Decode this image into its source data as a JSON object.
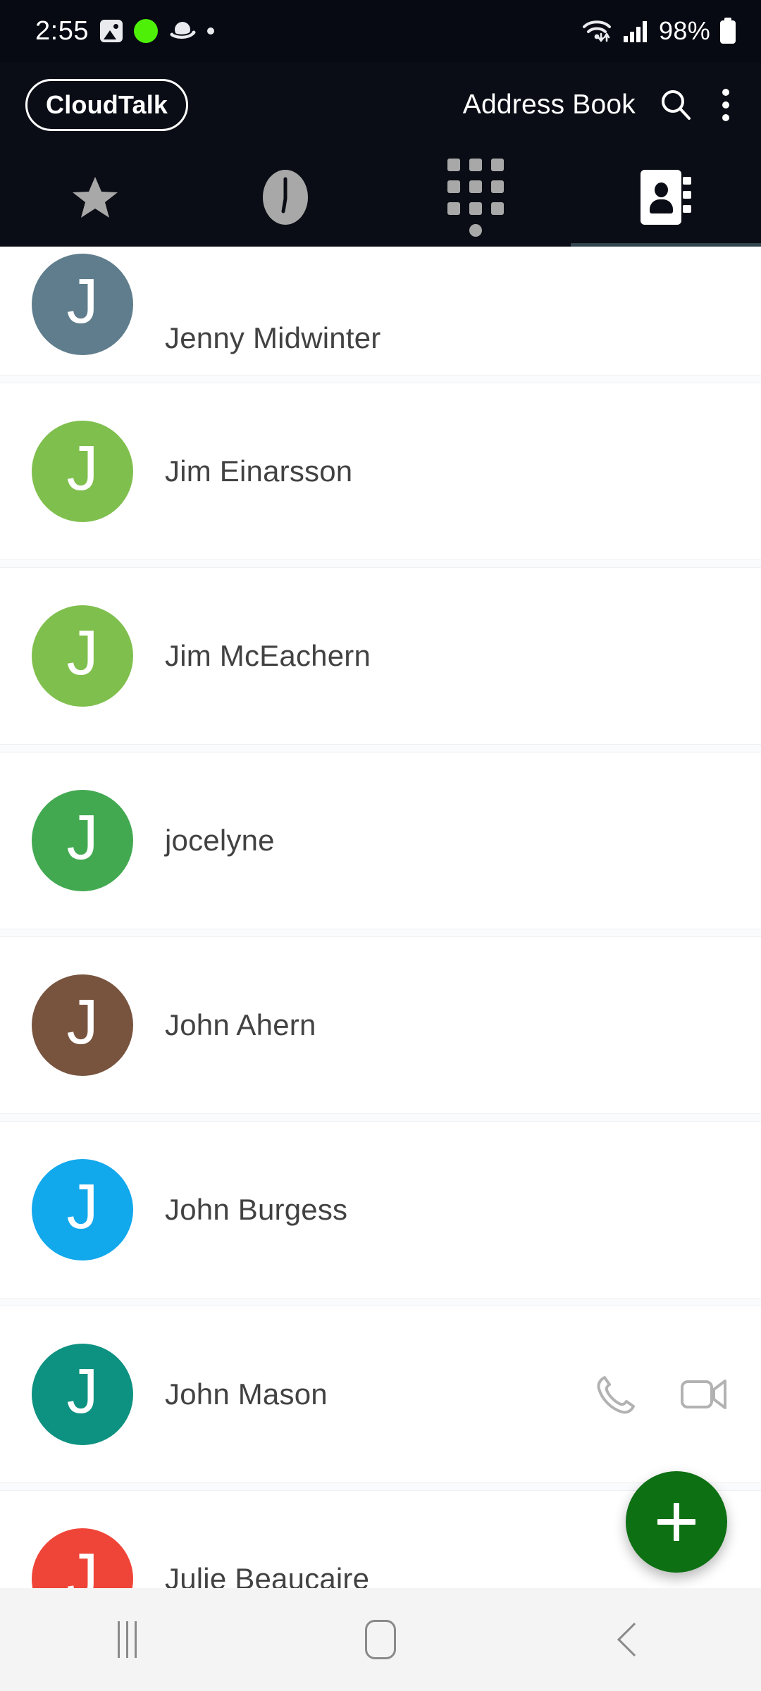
{
  "status_bar": {
    "time": "2:55",
    "battery_percent": "98%",
    "icons": [
      "photos-icon",
      "green-dot-icon",
      "planet-icon",
      "small-dot-icon",
      "wifi-icon",
      "signal-icon",
      "battery-icon"
    ]
  },
  "header": {
    "brand": "CloudTalk",
    "title": "Address Book",
    "search_icon": "search-icon",
    "overflow_icon": "more-vertical-icon"
  },
  "tabs": {
    "items": [
      {
        "name": "favorites",
        "icon": "star-icon",
        "active": false
      },
      {
        "name": "recents",
        "icon": "clock-icon",
        "active": false
      },
      {
        "name": "dialpad",
        "icon": "dialpad-icon",
        "active": false
      },
      {
        "name": "contacts",
        "icon": "contacts-book-icon",
        "active": true
      }
    ],
    "indicator_color": "#32444C"
  },
  "contacts": [
    {
      "name": "Jenny Midwinter",
      "initial": "J",
      "avatar_color": "#5F7D8C",
      "partial": true,
      "actions": false
    },
    {
      "name": "Jim Einarsson",
      "initial": "J",
      "avatar_color": "#7FBF4D",
      "partial": false,
      "actions": false
    },
    {
      "name": "Jim McEachern",
      "initial": "J",
      "avatar_color": "#7FBF4D",
      "partial": false,
      "actions": false
    },
    {
      "name": "jocelyne",
      "initial": "J",
      "avatar_color": "#42A951",
      "partial": false,
      "actions": false
    },
    {
      "name": "John Ahern",
      "initial": "J",
      "avatar_color": "#78543F",
      "partial": false,
      "actions": false
    },
    {
      "name": "John Burgess",
      "initial": "J",
      "avatar_color": "#12A8EC",
      "partial": false,
      "actions": false
    },
    {
      "name": "John Mason",
      "initial": "J",
      "avatar_color": "#0D9180",
      "partial": false,
      "actions": true
    },
    {
      "name": "Julie Beaucaire",
      "initial": "J",
      "avatar_color": "#EF4538",
      "partial": false,
      "actions": false
    }
  ],
  "row_actions": {
    "call_icon": "phone-icon",
    "video_icon": "video-camera-icon"
  },
  "fab": {
    "label": "+",
    "icon": "plus-icon",
    "color": "#0D7013"
  },
  "nav_bar": {
    "recents": "recents-icon",
    "home": "home-icon",
    "back": "back-icon"
  }
}
